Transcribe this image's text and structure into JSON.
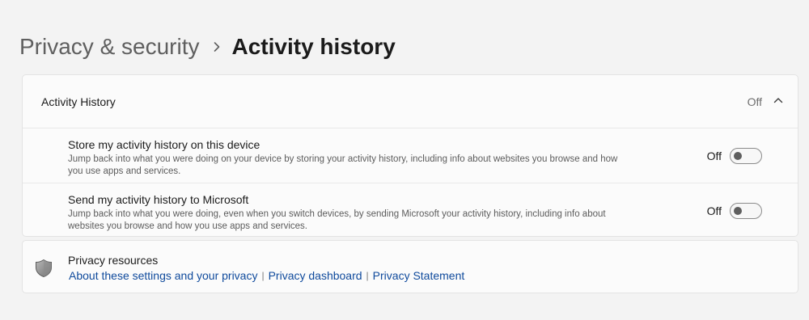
{
  "breadcrumb": {
    "parent": "Privacy & security",
    "current": "Activity history"
  },
  "activity_history": {
    "title": "Activity History",
    "state": "Off",
    "expanded": true,
    "settings": [
      {
        "title": "Store my activity history on this device",
        "description": "Jump back into what you were doing on your device by storing your activity history, including info about websites you browse and how you use apps and services.",
        "state_label": "Off",
        "on": false
      },
      {
        "title": "Send my activity history to Microsoft",
        "description": "Jump back into what you were doing, even when you switch devices, by sending Microsoft your activity history, including info about websites you browse and how you use apps and services.",
        "state_label": "Off",
        "on": false
      }
    ]
  },
  "privacy_resources": {
    "title": "Privacy resources",
    "icon": "shield-icon",
    "links": [
      "About these settings and your privacy",
      "Privacy dashboard",
      "Privacy Statement"
    ]
  },
  "colors": {
    "link": "#0f4a9c",
    "background": "#f3f3f3",
    "card": "#fbfbfb"
  }
}
